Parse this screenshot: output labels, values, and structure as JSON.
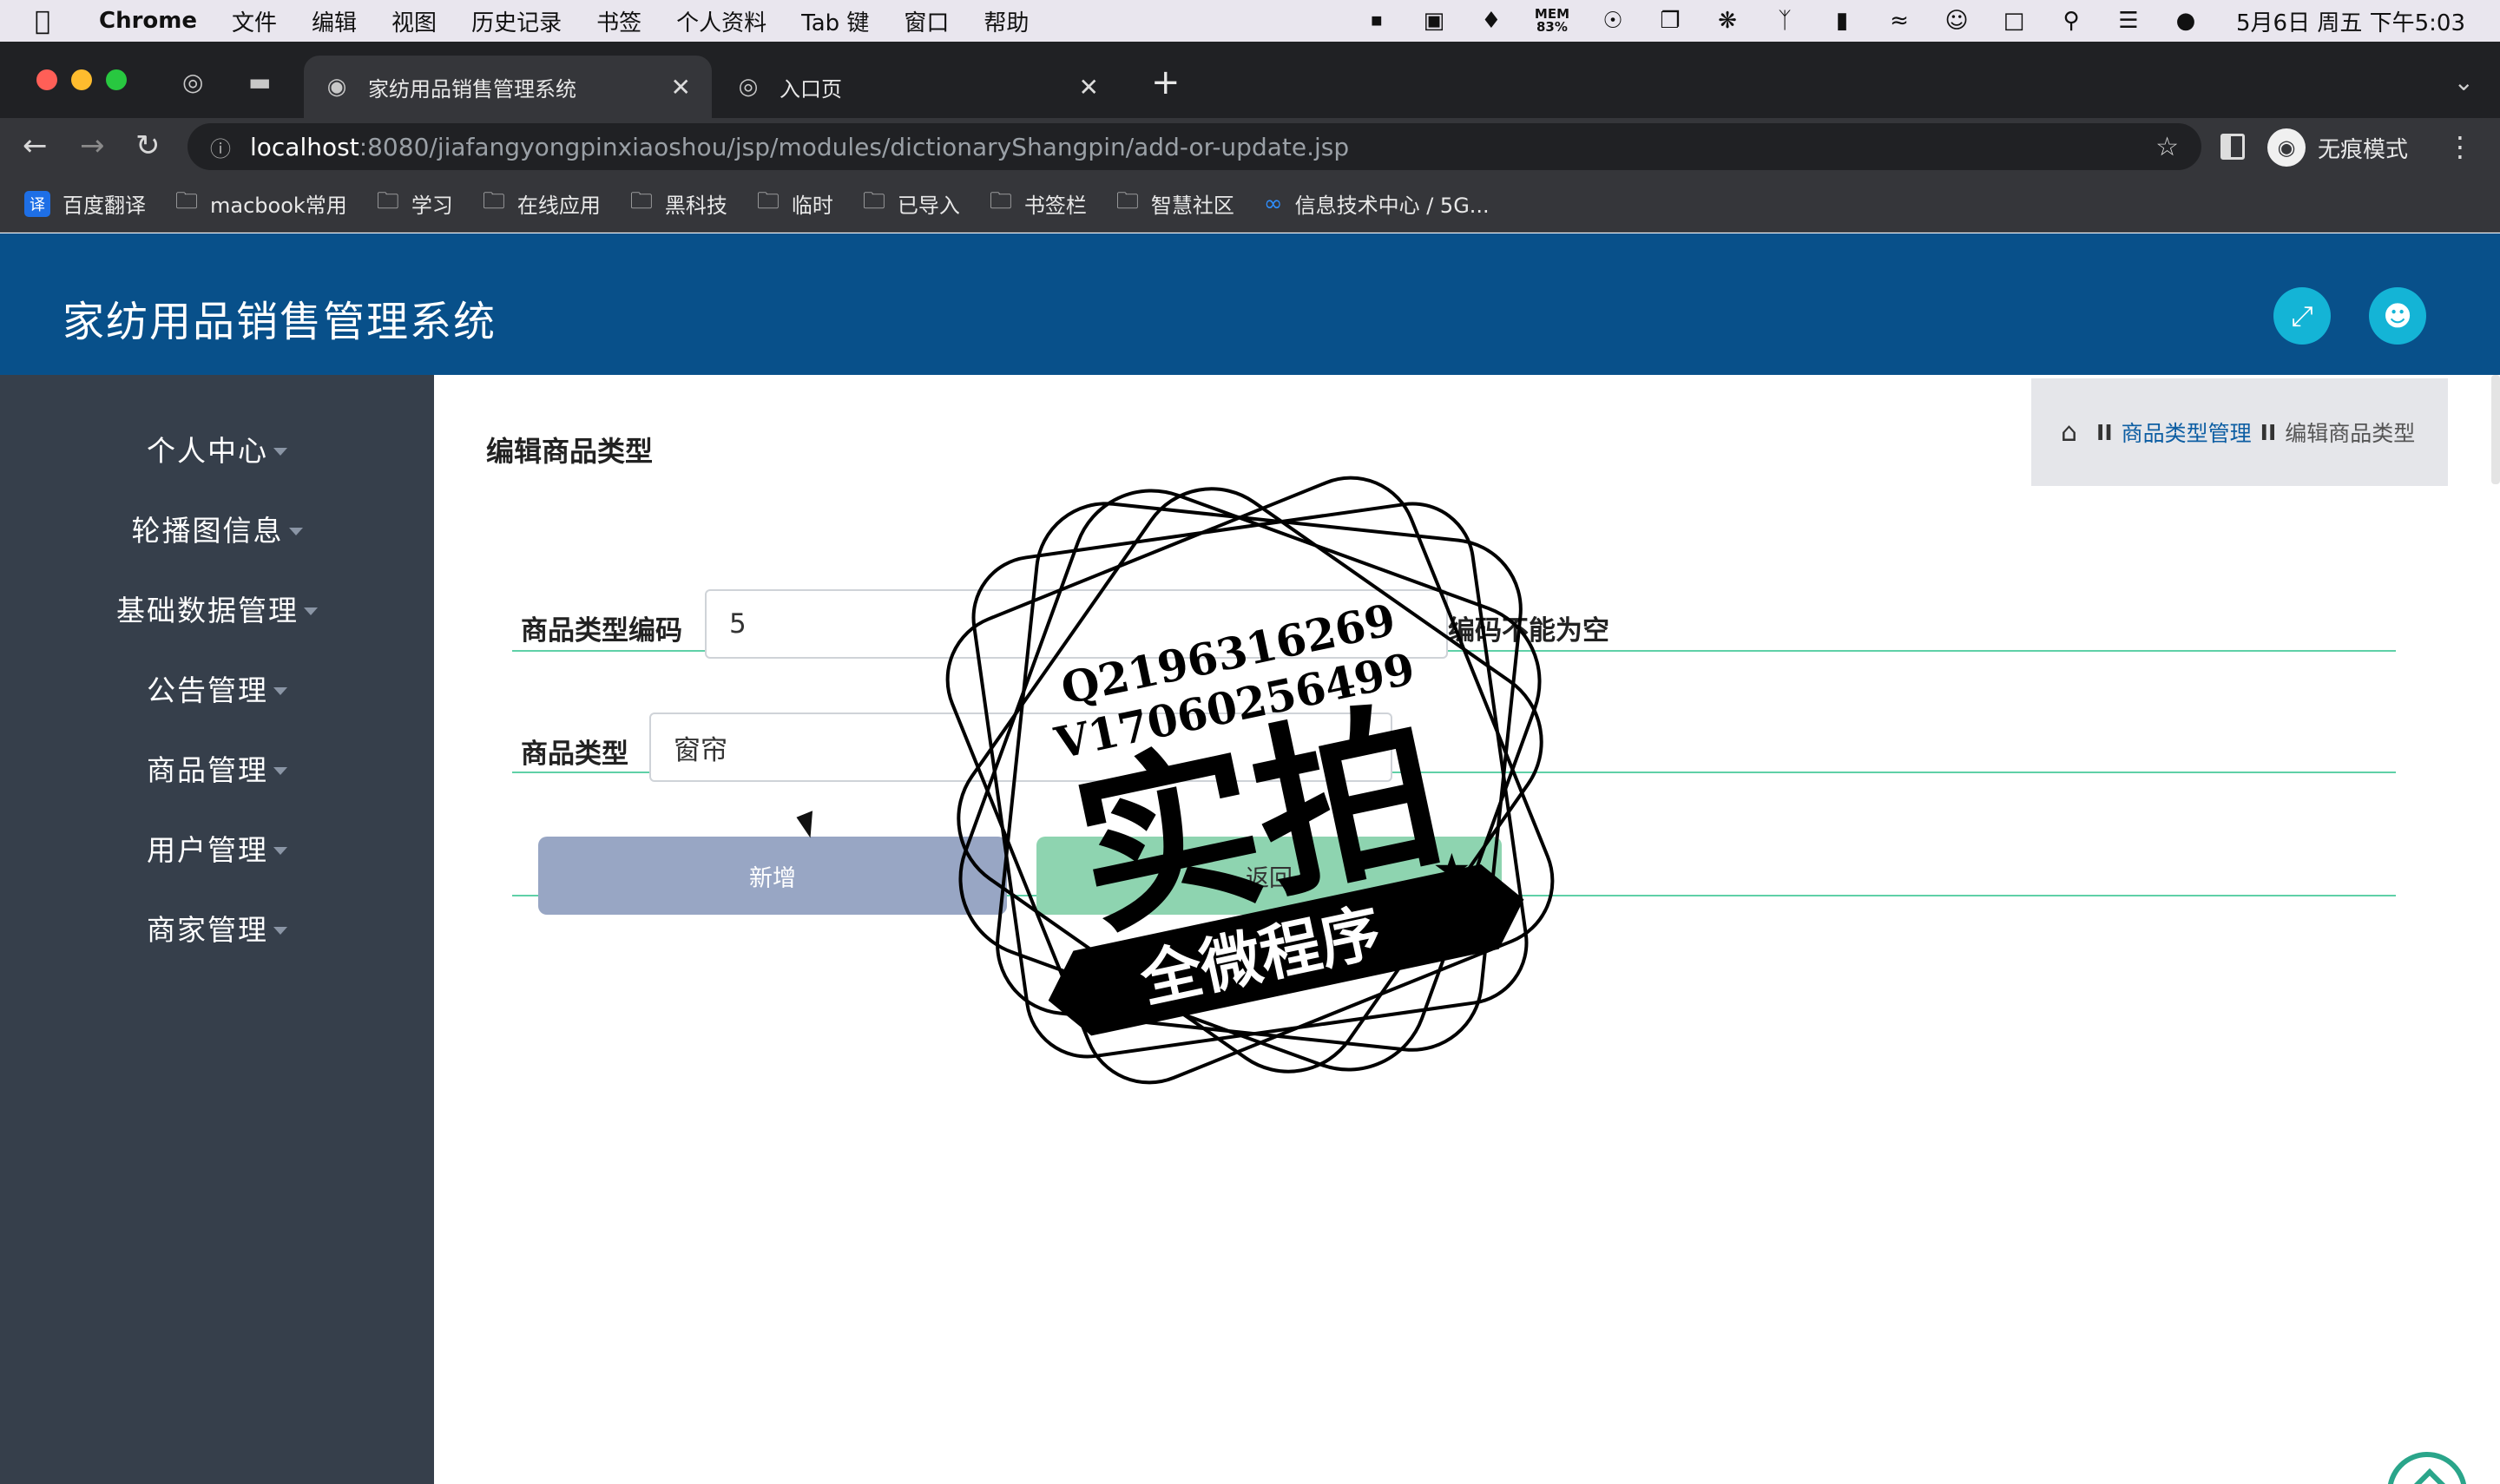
{
  "menubar": {
    "app_name": "Chrome",
    "items": [
      "文件",
      "编辑",
      "视图",
      "历史记录",
      "书签",
      "个人资料",
      "Tab 键",
      "窗口",
      "帮助"
    ],
    "mem_label": "MEM",
    "mem_value": "83%",
    "clock": "5月6日 周五 下午5:03"
  },
  "tabs": [
    {
      "title": "家纺用品销售管理系统",
      "active": true
    },
    {
      "title": "入口页",
      "active": false
    }
  ],
  "address": {
    "host": "localhost",
    "path": ":8080/jiafangyongpinxiaoshou/jsp/modules/dictionaryShangpin/add-or-update.jsp"
  },
  "incognito_label": "无痕模式",
  "bookmarks": [
    {
      "label": "百度翻译",
      "icon": "translate-icon"
    },
    {
      "label": "macbook常用",
      "icon": "folder-icon"
    },
    {
      "label": "学习",
      "icon": "folder-icon"
    },
    {
      "label": "在线应用",
      "icon": "folder-icon"
    },
    {
      "label": "黑科技",
      "icon": "folder-icon"
    },
    {
      "label": "临时",
      "icon": "folder-icon"
    },
    {
      "label": "已导入",
      "icon": "folder-icon"
    },
    {
      "label": "书签栏",
      "icon": "folder-icon"
    },
    {
      "label": "智慧社区",
      "icon": "folder-icon"
    },
    {
      "label": "信息技术中心 / 5G...",
      "icon": "infinity-icon"
    }
  ],
  "site": {
    "title": "家纺用品销售管理系统"
  },
  "sidebar": {
    "items": [
      "个人中心",
      "轮播图信息",
      "基础数据管理",
      "公告管理",
      "商品管理",
      "用户管理",
      "商家管理"
    ]
  },
  "form": {
    "title": "编辑商品类型",
    "code_label": "商品类型编码",
    "code_value": "5",
    "code_hint": "编码不能为空",
    "type_label": "商品类型",
    "type_value": "窗帘",
    "add_button": "新增",
    "back_button": "返回"
  },
  "breadcrumb": {
    "separator": "II",
    "parent": "商品类型管理",
    "current": "编辑商品类型"
  },
  "watermark": {
    "line1": "Q2196316269",
    "line2": "V17060256499",
    "big_text": "实拍",
    "ribbon_text": "全微程序"
  },
  "colors": {
    "header": "#08508a",
    "sidebar": "#363f4b",
    "accent_icon": "#14b4d6",
    "row_divider": "#5fd0a7"
  }
}
